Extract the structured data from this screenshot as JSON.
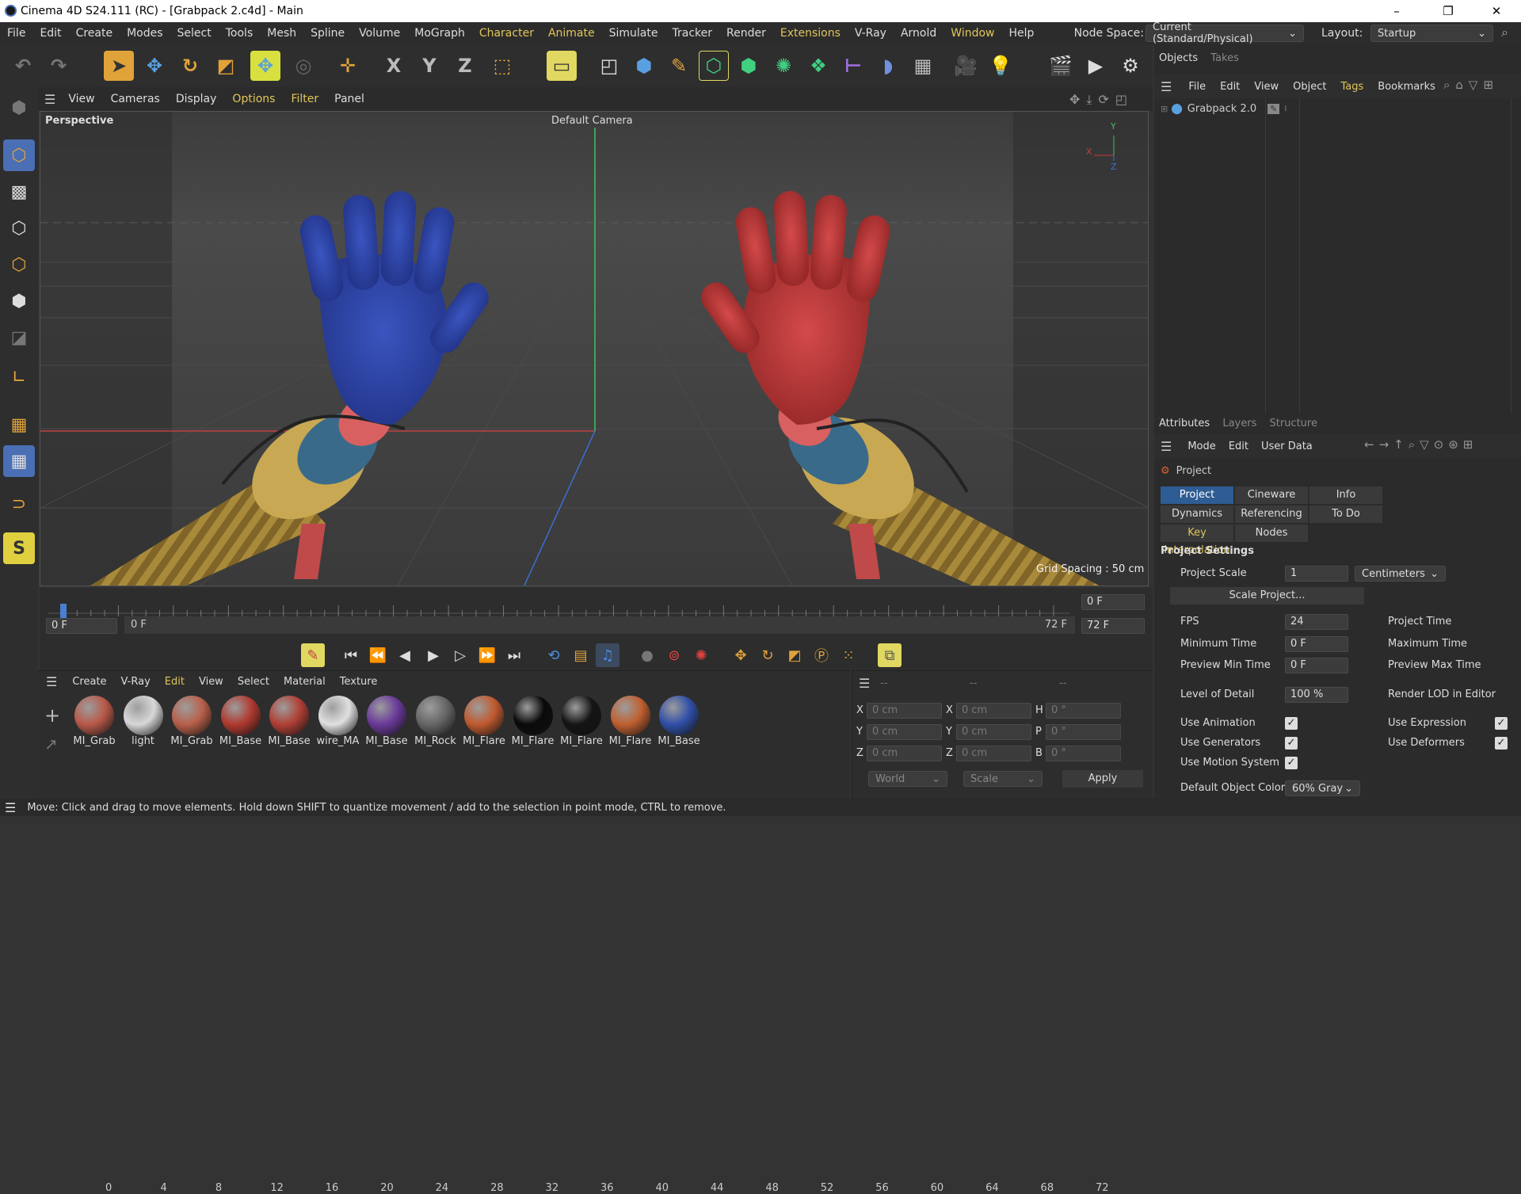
{
  "window": {
    "title": "Cinema 4D S24.111 (RC) - [Grabpack 2.c4d] - Main",
    "minimize": "–",
    "maximize": "❐",
    "close": "✕"
  },
  "menu": {
    "items": [
      "File",
      "Edit",
      "Create",
      "Modes",
      "Select",
      "Tools",
      "Mesh",
      "Spline",
      "Volume",
      "MoGraph",
      "Character",
      "Animate",
      "Simulate",
      "Tracker",
      "Render",
      "Extensions",
      "V-Ray",
      "Arnold",
      "Window",
      "Help"
    ],
    "highlighted": [
      "Character",
      "Animate",
      "Extensions",
      "Window"
    ],
    "node_space_label": "Node Space:",
    "node_space_value": "Current (Standard/Physical)",
    "layout_label": "Layout:",
    "layout_value": "Startup"
  },
  "toolbar": {
    "undo": "↶",
    "redo": "↷",
    "x_axis": "X",
    "y_axis": "Y",
    "z_axis": "Z"
  },
  "viewport_menu": {
    "items": [
      "View",
      "Cameras",
      "Display",
      "Options",
      "Filter",
      "Panel"
    ],
    "highlighted": [
      "Options",
      "Filter"
    ]
  },
  "viewport": {
    "name": "Perspective",
    "camera": "Default Camera",
    "grid_spacing": "Grid Spacing : 50 cm",
    "axis_x": "X",
    "axis_y": "Y",
    "axis_z": "Z"
  },
  "timeline": {
    "ticks": [
      "0",
      "4",
      "8",
      "12",
      "16",
      "20",
      "24",
      "28",
      "32",
      "36",
      "40",
      "44",
      "48",
      "52",
      "56",
      "60",
      "64",
      "68",
      "72"
    ],
    "current_frame": "0 F",
    "start_frame": "0 F",
    "range_start": "0 F",
    "range_end": "72 F",
    "end_frame": "72 F",
    "end_frame2": "72 F"
  },
  "materials": {
    "menu": [
      "Create",
      "V-Ray",
      "Edit",
      "View",
      "Select",
      "Material",
      "Texture"
    ],
    "highlighted": "Edit",
    "items": [
      {
        "name": "MI_Grab",
        "color": "#b85a4a"
      },
      {
        "name": "light",
        "color": "#d8d8d8"
      },
      {
        "name": "MI_Grab",
        "color": "#b8604a"
      },
      {
        "name": "MI_Base",
        "color": "#b03a30"
      },
      {
        "name": "MI_Base",
        "color": "#b04035"
      },
      {
        "name": "wire_MA",
        "color": "#e0e0e0"
      },
      {
        "name": "MI_Base",
        "color": "#6a3a9a"
      },
      {
        "name": "MI_Rock",
        "color": "#666666"
      },
      {
        "name": "MI_Flare",
        "color": "#c05a30"
      },
      {
        "name": "MI_Flare",
        "color": "#0a0a0a"
      },
      {
        "name": "MI_Flare",
        "color": "#151515"
      },
      {
        "name": "MI_Flare",
        "color": "#c06030"
      },
      {
        "name": "MI_Base",
        "color": "#3050a8"
      }
    ]
  },
  "coords": {
    "headers": [
      "--",
      "--",
      "--"
    ],
    "rows": [
      {
        "a": "X",
        "av": "0 cm",
        "b": "X",
        "bv": "0 cm",
        "c": "H",
        "cv": "0 °"
      },
      {
        "a": "Y",
        "av": "0 cm",
        "b": "Y",
        "bv": "0 cm",
        "c": "P",
        "cv": "0 °"
      },
      {
        "a": "Z",
        "av": "0 cm",
        "b": "Z",
        "bv": "0 cm",
        "c": "B",
        "cv": "0 °"
      }
    ],
    "world": "World",
    "scale": "Scale",
    "apply": "Apply"
  },
  "status": {
    "text": "Move: Click and drag to move elements. Hold down SHIFT to quantize movement / add to the selection in point mode, CTRL to remove."
  },
  "objects": {
    "tabs": [
      "Objects",
      "Takes"
    ],
    "menu": [
      "File",
      "Edit",
      "View",
      "Object",
      "Tags",
      "Bookmarks"
    ],
    "highlighted": "Tags",
    "tree": [
      {
        "name": "Grabpack 2.0"
      }
    ]
  },
  "attributes": {
    "tabs": [
      "Attributes",
      "Layers",
      "Structure"
    ],
    "menu": [
      "Mode",
      "Edit",
      "User Data"
    ],
    "object": "Project",
    "buttons": [
      "Project Settings",
      "Cineware",
      "Info",
      "Dynamics",
      "Referencing",
      "To Do",
      "Key Interpolation",
      "Nodes"
    ],
    "section": "Project Settings",
    "project_scale_label": "Project Scale",
    "project_scale": "1",
    "project_scale_unit": "Centimeters",
    "scale_project": "Scale Project...",
    "fps_label": "FPS",
    "fps": "24",
    "project_time_label": "Project Time",
    "min_time_label": "Minimum Time",
    "min_time": "0 F",
    "max_time_label": "Maximum Time",
    "preview_min_label": "Preview Min Time",
    "preview_min": "0 F",
    "preview_max_label": "Preview Max Time",
    "lod_label": "Level of Detail",
    "lod": "100 %",
    "render_lod_label": "Render LOD in Editor",
    "use_animation": "Use Animation",
    "use_expression": "Use Expression",
    "use_generators": "Use Generators",
    "use_deformers": "Use Deformers",
    "use_motion": "Use Motion System",
    "default_color_label": "Default Object Color",
    "default_color": "60% Gray"
  }
}
